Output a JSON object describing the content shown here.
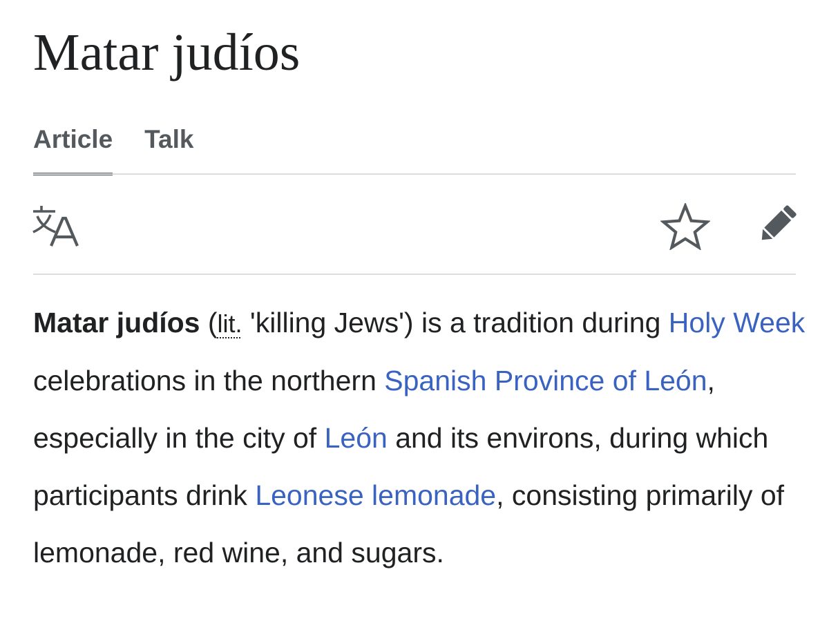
{
  "page": {
    "title": "Matar judíos"
  },
  "tabs": [
    {
      "label": "Article",
      "active": true
    },
    {
      "label": "Talk",
      "active": false
    }
  ],
  "toolbar": {
    "language_icon": "language-icon",
    "watch_icon": "star-icon",
    "edit_icon": "pencil-icon"
  },
  "article": {
    "lead": {
      "term": "Matar judíos",
      "paren_open": " (",
      "abbr": "lit.",
      "gloss": " 'killing Jews') is a tradition during ",
      "link_holy_week": "Holy Week",
      "text_2": " celebrations in the northern ",
      "link_province": "Spanish Province of León",
      "text_3": ", especially in the city of ",
      "link_leon": "León",
      "text_4": " and its environs, during which participants drink ",
      "link_lemonade": "Leonese lemonade",
      "text_5": ", consisting primarily of lemonade, red wine, and sugars."
    }
  },
  "colors": {
    "text": "#202122",
    "link": "#3a62c1",
    "tab": "#54595d",
    "divider": "#dadcdf"
  }
}
